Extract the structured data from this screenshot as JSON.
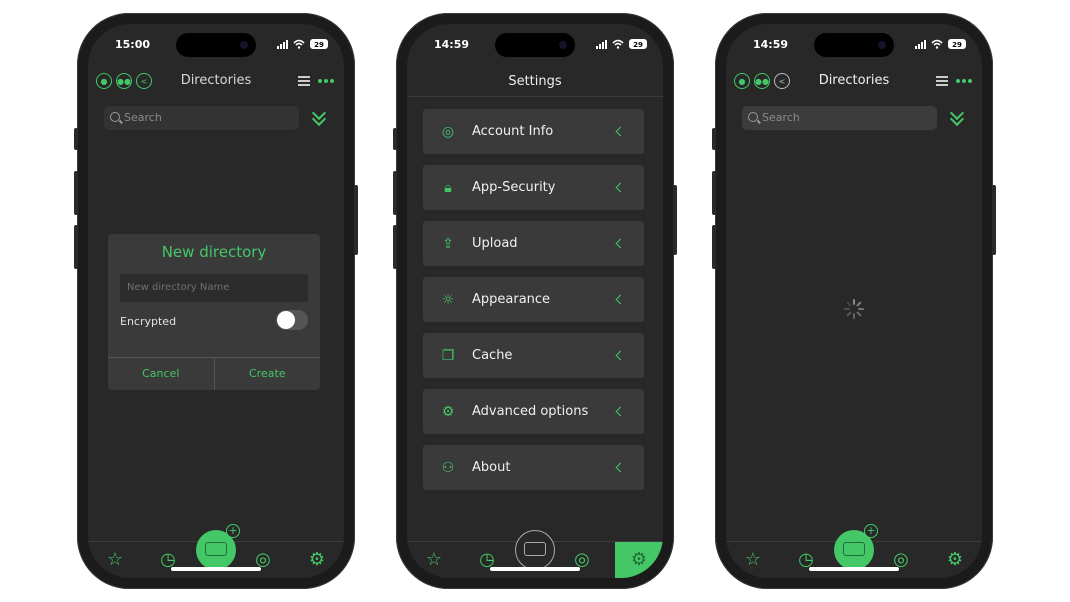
{
  "phones": {
    "left": {
      "status": {
        "time": "15:00",
        "battery": "29"
      },
      "header": {
        "title": "Directories"
      },
      "search": {
        "placeholder": "Search"
      },
      "dialog": {
        "title": "New directory",
        "input_placeholder": "New directory Name",
        "toggle_label": "Encrypted",
        "cancel_label": "Cancel",
        "create_label": "Create"
      }
    },
    "middle": {
      "status": {
        "time": "14:59",
        "battery": "29"
      },
      "header": {
        "title": "Settings"
      },
      "items": [
        {
          "label": "Account Info",
          "icon": "account-icon"
        },
        {
          "label": "App-Security",
          "icon": "lock-icon"
        },
        {
          "label": "Upload",
          "icon": "upload-icon"
        },
        {
          "label": "Appearance",
          "icon": "sun-icon"
        },
        {
          "label": "Cache",
          "icon": "cache-icon"
        },
        {
          "label": "Advanced options",
          "icon": "gear-icon"
        },
        {
          "label": "About",
          "icon": "people-icon"
        }
      ]
    },
    "right": {
      "status": {
        "time": "14:59",
        "battery": "29"
      },
      "header": {
        "title": "Directories"
      },
      "search": {
        "placeholder": "Search"
      }
    }
  },
  "colors": {
    "accent": "#44c767",
    "background": "#282828",
    "card": "#3a3a3a"
  }
}
